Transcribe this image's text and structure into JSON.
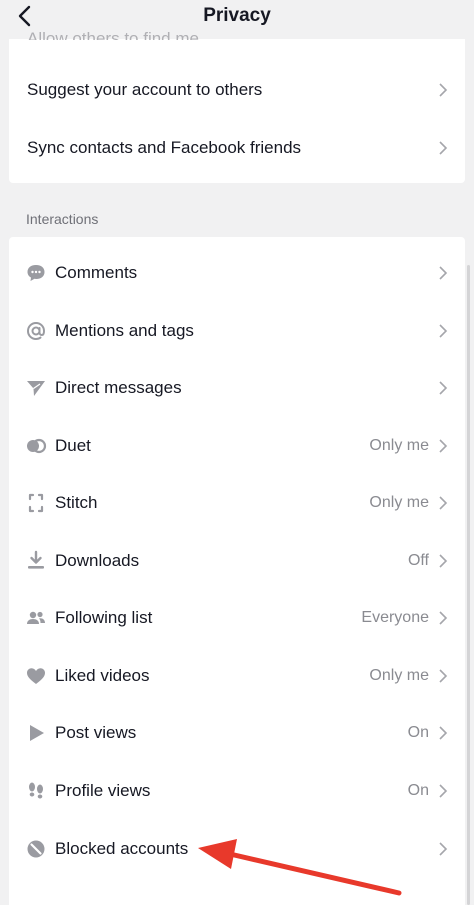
{
  "header": {
    "title": "Privacy"
  },
  "top_section": {
    "cut_off_text": "Allow others to find me",
    "items": [
      {
        "label": "Suggest your account to others"
      },
      {
        "label": "Sync contacts and Facebook friends"
      }
    ]
  },
  "interactions": {
    "title": "Interactions",
    "items": [
      {
        "label": "Comments",
        "value": "",
        "icon": "comment-icon"
      },
      {
        "label": "Mentions and tags",
        "value": "",
        "icon": "at-icon"
      },
      {
        "label": "Direct messages",
        "value": "",
        "icon": "send-icon"
      },
      {
        "label": "Duet",
        "value": "Only me",
        "icon": "duet-icon"
      },
      {
        "label": "Stitch",
        "value": "Only me",
        "icon": "stitch-icon"
      },
      {
        "label": "Downloads",
        "value": "Off",
        "icon": "download-icon"
      },
      {
        "label": "Following list",
        "value": "Everyone",
        "icon": "people-icon"
      },
      {
        "label": "Liked videos",
        "value": "Only me",
        "icon": "heart-icon"
      },
      {
        "label": "Post views",
        "value": "On",
        "icon": "play-icon"
      },
      {
        "label": "Profile views",
        "value": "On",
        "icon": "footprints-icon"
      },
      {
        "label": "Blocked accounts",
        "value": "",
        "icon": "block-icon"
      }
    ]
  },
  "colors": {
    "background": "#f1f1f2",
    "card": "#ffffff",
    "text": "#161823",
    "secondary": "#8a8b91",
    "icon": "#9a9ba1",
    "annotation_arrow": "#e8392b"
  }
}
